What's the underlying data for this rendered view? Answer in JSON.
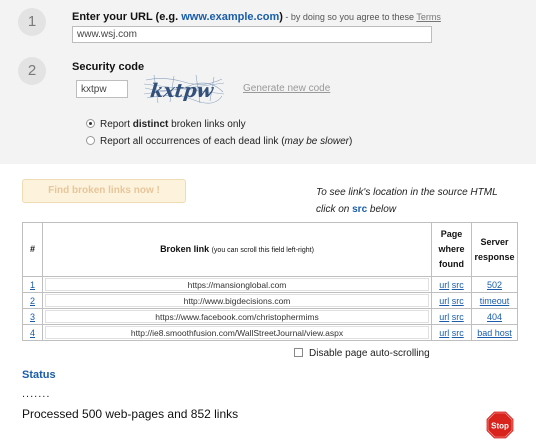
{
  "step1": {
    "number": "1",
    "label": "Enter your URL (e.g. ",
    "example": "www.example.com",
    "label_close": ")",
    "consent": " - by doing so you agree to these ",
    "terms_link": "Terms",
    "url_value": "www.wsj.com"
  },
  "step2": {
    "number": "2",
    "label": "Security code",
    "code_value": "kxtpw",
    "captcha_text": "kxtpw",
    "generate_link": "Generate new code"
  },
  "options": {
    "distinct_pre": "Report ",
    "distinct_bold": "distinct",
    "distinct_post": " broken links only",
    "all_pre": "Report all occurrences of each dead link (",
    "all_italic": "may be slower",
    "all_post": ")",
    "selected": "distinct"
  },
  "find_button": "Find broken links now !",
  "hint": {
    "line1": "To see link's location in the source HTML",
    "line2_pre": "click on ",
    "line2_src": "src",
    "line2_post": " below"
  },
  "table": {
    "col_num": "#",
    "col_link": "Broken link",
    "col_link_note": "(you can scroll this field left-right)",
    "col_found_1": "Page",
    "col_found_2": "where",
    "col_found_3": "found",
    "col_resp_1": "Server",
    "col_resp_2": "response",
    "rows": [
      {
        "num": "1",
        "url": "https://mansionglobal.com",
        "found_url": "url",
        "found_src": "src",
        "response": "502"
      },
      {
        "num": "2",
        "url": "http://www.bigdecisions.com",
        "found_url": "url",
        "found_src": "src",
        "response": "timeout"
      },
      {
        "num": "3",
        "url": "https://www.facebook.com/christophermims",
        "found_url": "url",
        "found_src": "src",
        "response": "404"
      },
      {
        "num": "4",
        "url": "http://ie8.smoothfusion.com/WallStreetJournal/view.aspx",
        "found_url": "url",
        "found_src": "src",
        "response": "bad host"
      }
    ]
  },
  "autoscroll_label": "Disable page auto-scrolling",
  "status": {
    "title": "Status",
    "dots": ".......",
    "processed": "Processed 500 web-pages and 852 links",
    "stop_label": "Stop"
  },
  "colors": {
    "accent": "#1a5dac",
    "stop": "#d9231d"
  }
}
